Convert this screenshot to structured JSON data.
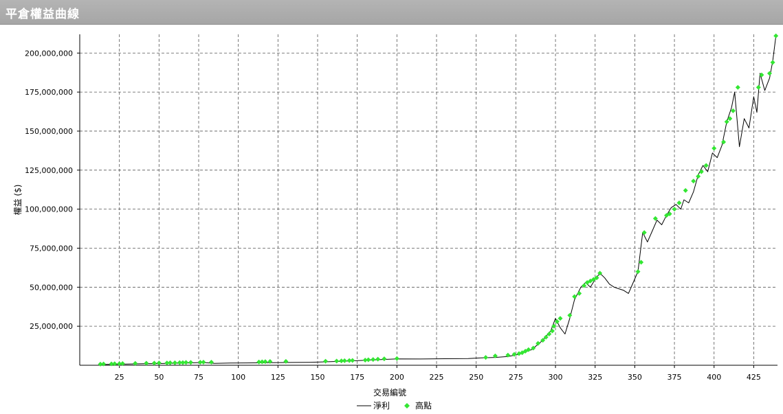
{
  "window": {
    "title": "平倉權益曲線"
  },
  "chart_data": {
    "type": "line",
    "title": "平倉權益曲線",
    "xlabel": "交易編號",
    "ylabel": "權益 ($)",
    "xlim": [
      0,
      440
    ],
    "ylim": [
      0,
      212000000
    ],
    "x_ticks": [
      25,
      50,
      75,
      100,
      125,
      150,
      175,
      200,
      225,
      250,
      275,
      300,
      325,
      350,
      375,
      400,
      425
    ],
    "x_tick_labels": [
      "25",
      "50",
      "75",
      "100",
      "125",
      "150",
      "175",
      "200",
      "225",
      "250",
      "275",
      "300",
      "325",
      "350",
      "375",
      "400",
      "425"
    ],
    "y_ticks": [
      25000000,
      50000000,
      75000000,
      100000000,
      125000000,
      150000000,
      175000000,
      200000000
    ],
    "y_tick_labels": [
      "25,000,000",
      "50,000,000",
      "75,000,000",
      "100,000,000",
      "125,000,000",
      "150,000,000",
      "175,000,000",
      "200,000,000"
    ],
    "grid": true,
    "legend_position": "bottom-center",
    "series": [
      {
        "name": "淨利",
        "kind": "line",
        "color": "#000000",
        "x": [
          13,
          20,
          30,
          40,
          50,
          60,
          70,
          77,
          85,
          95,
          105,
          115,
          125,
          135,
          145,
          155,
          165,
          172,
          180,
          190,
          200,
          215,
          230,
          245,
          253,
          262,
          270,
          277,
          285,
          292,
          297,
          300,
          303,
          306,
          309,
          312,
          316,
          319,
          322,
          325,
          328,
          331,
          334,
          337,
          340,
          343,
          346,
          349,
          352,
          355,
          358,
          361,
          364,
          367,
          370,
          373,
          376,
          379,
          381,
          384,
          387,
          390,
          393,
          396,
          399,
          402,
          405,
          408,
          411,
          413,
          416,
          419,
          422,
          425,
          427,
          429,
          432,
          435,
          437,
          439
        ],
        "y": [
          500000,
          600000,
          800000,
          1000000,
          1100000,
          1300000,
          1500000,
          1800000,
          1200000,
          1400000,
          1500000,
          1600000,
          1700000,
          1800000,
          1900000,
          2200000,
          2500000,
          2800000,
          3200000,
          3600000,
          4100000,
          4000000,
          4200000,
          4300000,
          4700000,
          5000000,
          5600000,
          7000000,
          10000000,
          16000000,
          22000000,
          30000000,
          24000000,
          20000000,
          30000000,
          42000000,
          50000000,
          53000000,
          50000000,
          55000000,
          59000000,
          56000000,
          52000000,
          50000000,
          49000000,
          48000000,
          46000000,
          53000000,
          60000000,
          85000000,
          79000000,
          86000000,
          93000000,
          90000000,
          96000000,
          101000000,
          103000000,
          100000000,
          106000000,
          104000000,
          111000000,
          122000000,
          128000000,
          124000000,
          136000000,
          133000000,
          141000000,
          156000000,
          165000000,
          175000000,
          140000000,
          158000000,
          152000000,
          172000000,
          162000000,
          187000000,
          176000000,
          184000000,
          195000000,
          211000000
        ]
      },
      {
        "name": "高點",
        "kind": "markers",
        "color": "#33e633",
        "x": [
          13,
          15,
          20,
          22,
          25,
          27,
          35,
          42,
          47,
          50,
          55,
          57,
          60,
          63,
          65,
          67,
          70,
          76,
          78,
          83,
          113,
          115,
          117,
          120,
          130,
          155,
          162,
          165,
          167,
          170,
          172,
          180,
          182,
          185,
          188,
          192,
          200,
          256,
          262,
          270,
          274,
          277,
          279,
          281,
          283,
          286,
          289,
          292,
          294,
          296,
          298,
          299,
          301,
          303,
          309,
          312,
          315,
          318,
          320,
          322,
          324,
          326,
          328,
          352,
          354,
          356,
          363,
          370,
          372,
          375,
          378,
          382,
          387,
          390,
          392,
          395,
          400,
          406,
          408,
          410,
          412,
          415,
          428,
          430,
          435,
          437,
          439
        ],
        "y": [
          700000,
          800000,
          900000,
          1000000,
          1000000,
          1100000,
          1200000,
          1300000,
          1400000,
          1500000,
          1500000,
          1600000,
          1600000,
          1700000,
          1700000,
          1800000,
          1800000,
          1900000,
          2000000,
          2000000,
          2100000,
          2200000,
          2300000,
          2400000,
          2500000,
          2600000,
          2700000,
          2800000,
          2900000,
          3000000,
          3100000,
          3300000,
          3500000,
          3700000,
          3900000,
          4100000,
          4300000,
          5000000,
          6000000,
          6500000,
          7000000,
          7500000,
          8000000,
          9000000,
          10000000,
          11000000,
          14000000,
          16000000,
          18000000,
          20000000,
          22000000,
          25000000,
          28000000,
          30000000,
          32000000,
          44000000,
          46000000,
          51000000,
          53000000,
          54000000,
          55000000,
          56000000,
          59000000,
          60000000,
          66000000,
          85000000,
          94000000,
          96000000,
          97000000,
          100000000,
          104000000,
          112000000,
          118000000,
          121000000,
          124000000,
          128000000,
          139000000,
          143000000,
          156000000,
          158000000,
          163000000,
          178000000,
          178000000,
          186000000,
          187000000,
          194000000,
          211000000
        ]
      }
    ]
  }
}
